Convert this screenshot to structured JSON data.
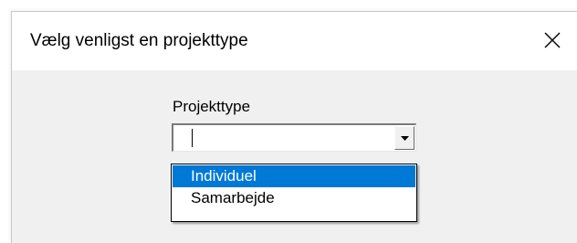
{
  "dialog": {
    "title": "Vælg venligst en projekttype",
    "close_icon": "close-icon"
  },
  "form": {
    "field_label": "Projekttype",
    "combo_value": "",
    "dropdown_arrow_icon": "chevron-down-icon",
    "options": [
      {
        "label": "Individuel",
        "selected": true
      },
      {
        "label": "Samarbejde",
        "selected": false
      }
    ]
  },
  "colors": {
    "dialog_bg": "#f0f0f0",
    "titlebar_bg": "#ffffff",
    "selection": "#0078d7",
    "selection_text": "#ffffff"
  }
}
